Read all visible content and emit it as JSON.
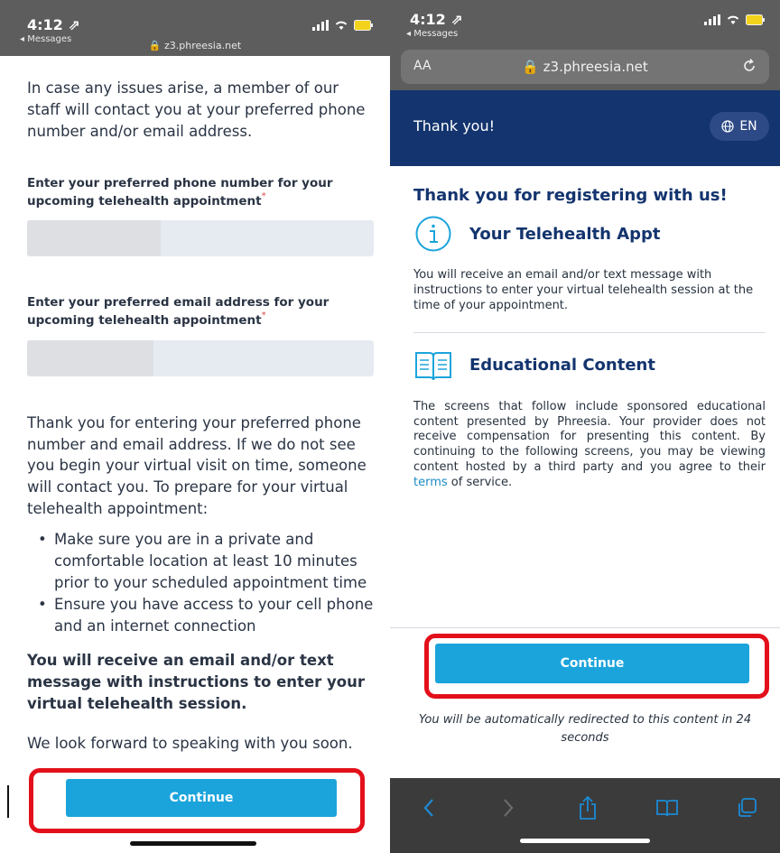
{
  "left": {
    "status": {
      "time": "4:12 ⇗",
      "back_app": "◂ Messages",
      "url": "🔒 z3.phreesia.net"
    },
    "intro": "In case any issues arise, a member of our staff will contact you at your preferred phone number and/or email address.",
    "phone_label": "Enter your preferred phone number for your upcoming telehealth appointment",
    "email_label": "Enter your preferred email address for your upcoming telehealth appointment",
    "required_mark": "*",
    "phone_value": "",
    "email_value": "",
    "thanks_paragraph": "Thank you for entering your preferred phone number and email address. If we do not see you begin your virtual visit on time, someone will contact you. To prepare for your virtual telehealth appointment:",
    "bullets": [
      "Make sure you are in a private and comfortable location at least 10 minutes prior to your scheduled appointment time",
      "Ensure you have access to your cell phone and an internet connection"
    ],
    "bold_notice": "You will receive an email and/or text message with instructions to enter your virtual telehealth session.",
    "closing": "We look forward to speaking with you soon.",
    "continue_label": "Continue"
  },
  "right": {
    "status": {
      "time": "4:12 ⇗",
      "back_app": "◂ Messages"
    },
    "urlbar": {
      "aa": "AA",
      "url": "🔒 z3.phreesia.net"
    },
    "nav": {
      "title": "Thank you!",
      "lang": "EN"
    },
    "heading": "Thank you for registering with us!",
    "sections": [
      {
        "title": "Your Telehealth Appt",
        "icon": "info-icon",
        "text": "You will receive an email and/or text message with instructions to enter your virtual telehealth session at the time of your appointment."
      },
      {
        "title": "Educational Content",
        "icon": "book-icon",
        "text": "The screens that follow include sponsored educational content presented by Phreesia. Your provider does not receive compensation for presenting this content. By continuing to the following screens, you may be viewing content hosted by a third party and you agree to their",
        "link": "terms",
        "text_after": "of service."
      }
    ],
    "continue_label": "Continue",
    "redirect_text": "You will be automatically redirected to this content in 24 seconds",
    "toolbar_icons": [
      "back-icon",
      "forward-icon",
      "share-icon",
      "bookmarks-icon",
      "tabs-icon"
    ]
  },
  "colors": {
    "accent_blue": "#1ba4db",
    "navy": "#13346e",
    "highlight_red": "#e3101b",
    "required_red": "#d94848"
  }
}
